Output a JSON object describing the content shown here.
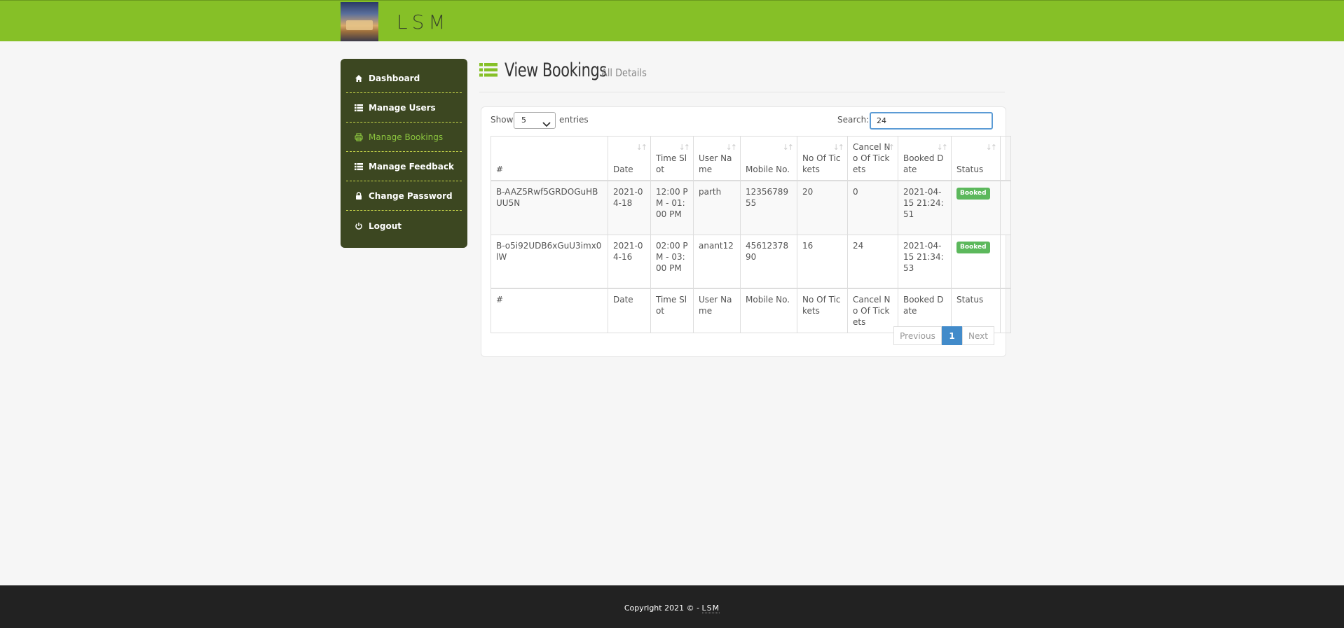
{
  "header": {
    "brand": "LSM"
  },
  "sidebar": {
    "items": [
      {
        "label": "Dashboard",
        "icon": "home-icon"
      },
      {
        "label": "Manage Users",
        "icon": "list-icon"
      },
      {
        "label": "Manage Bookings",
        "icon": "print-icon",
        "active": true
      },
      {
        "label": "Manage Feedback",
        "icon": "list-icon"
      },
      {
        "label": "Change Password",
        "icon": "lock-icon"
      },
      {
        "label": "Logout",
        "icon": "power-icon"
      }
    ]
  },
  "page": {
    "title": "View Bookings",
    "subtitle": "All Details"
  },
  "table_controls": {
    "show_label": "Show",
    "entries_value": "5",
    "entries_label": "entries",
    "search_label": "Search:",
    "search_value": "24"
  },
  "table": {
    "columns": [
      "#",
      "Date",
      "Time Slot",
      "User Name",
      "Mobile No.",
      "No Of Tickets",
      "Cancel No Of Tickets",
      "Booked Date",
      "Status"
    ],
    "rows": [
      [
        "B-AAZ5Rwf5GRDOGuHBUU5N",
        "2021-04-18",
        "12:00 PM - 01:00 PM",
        "parth",
        "1235678955",
        "20",
        "0",
        "2021-04-15 21:24:51",
        "Booked"
      ],
      [
        "B-o5i92UDB6xGuU3imx0lW",
        "2021-04-16",
        "02:00 PM - 03:00 PM",
        "anant12",
        "4561237890",
        "16",
        "24",
        "2021-04-15 21:34:53",
        "Booked"
      ]
    ]
  },
  "pagination": {
    "previous": "Previous",
    "current": "1",
    "next": "Next"
  },
  "footer": {
    "copyright": "Copyright 2021 © - ",
    "brand": "LSM"
  },
  "colors": {
    "accent": "#86c027",
    "sidebar": "#3c4721",
    "badge": "#5cb85c",
    "pager_active": "#428bca"
  }
}
